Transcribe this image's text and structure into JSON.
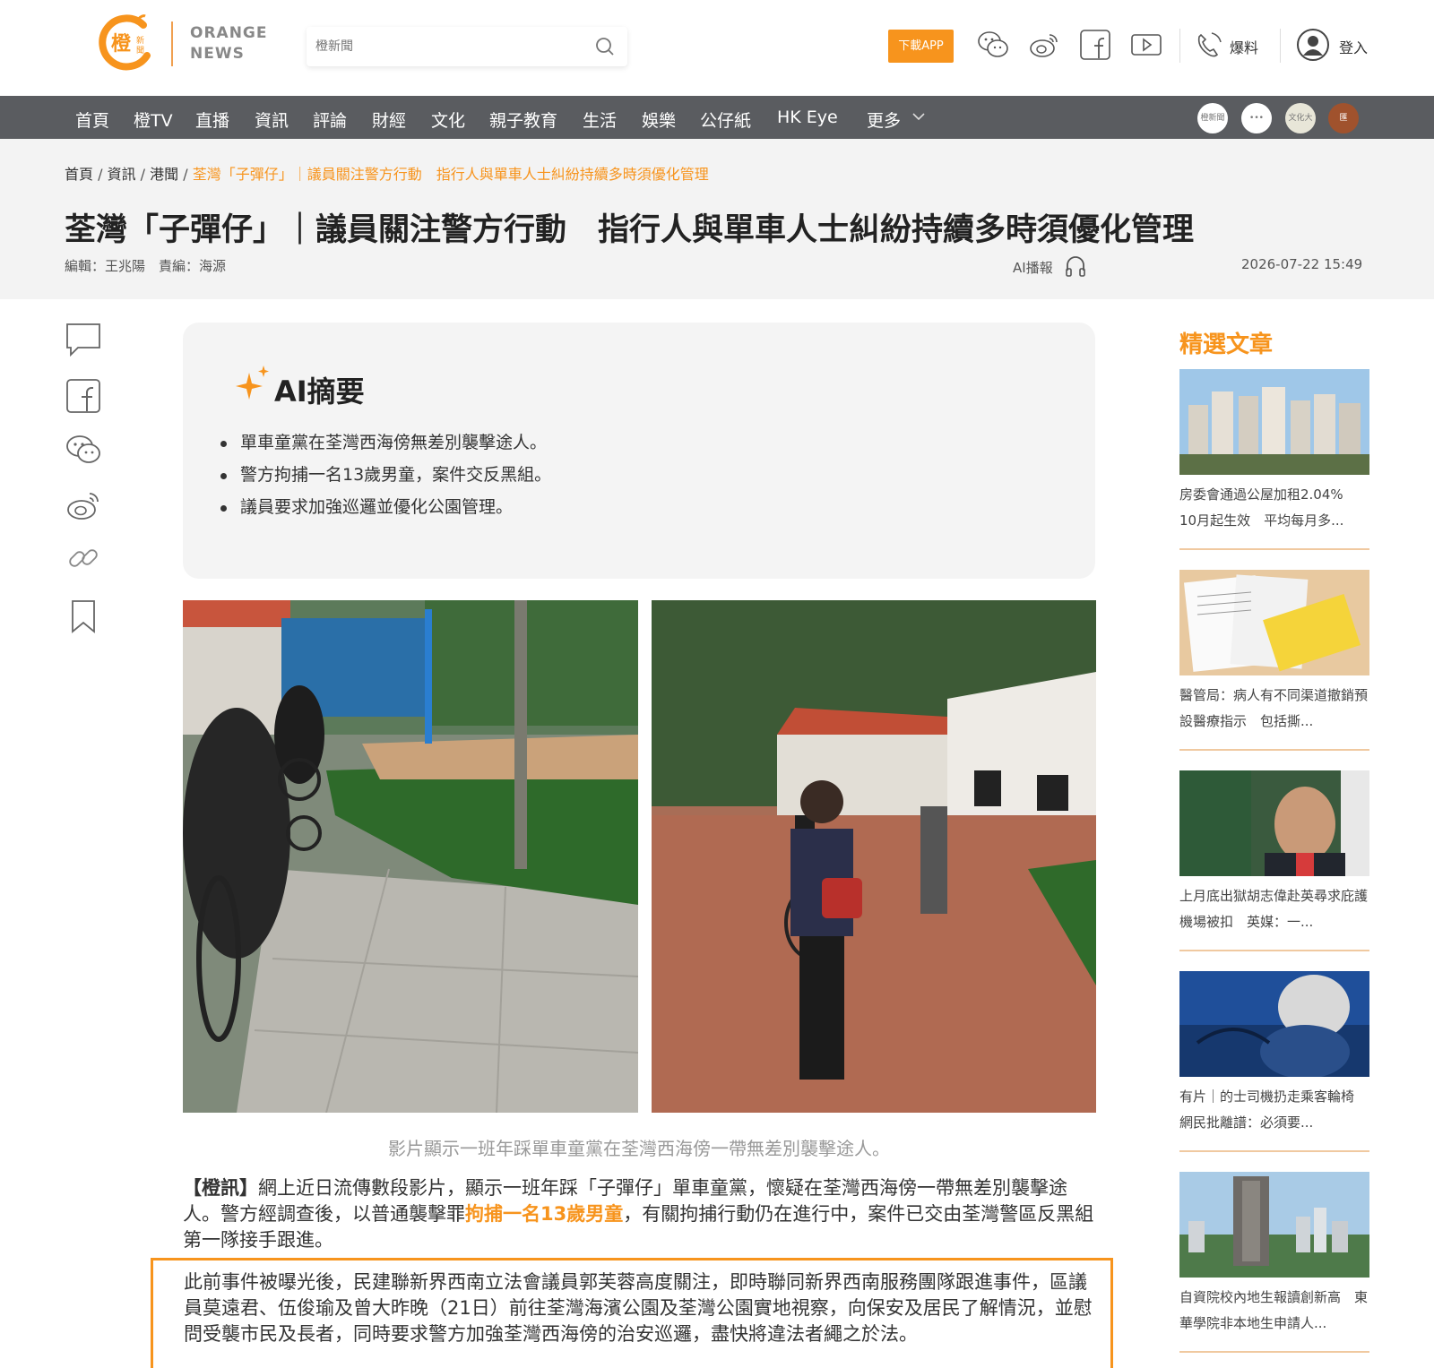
{
  "header": {
    "logo_glyph": "橙",
    "logo_small": "新聞",
    "logo_text_1": "ORANGE",
    "logo_text_2": "NEWS",
    "search_placeholder": "橙新聞",
    "download_app": "下載APP",
    "report_label": "爆料",
    "login_label": "登入"
  },
  "nav": {
    "items": [
      "首頁",
      "橙TV",
      "直播",
      "資訊",
      "評論",
      "財經",
      "文化",
      "親子教育",
      "生活",
      "娛樂",
      "公仔紙",
      "HK Eye",
      "更多"
    ],
    "circles": [
      "橙新聞",
      "•••",
      "文化大匯",
      "匯"
    ]
  },
  "breadcrumb": {
    "items": [
      "首頁",
      "資訊",
      "港聞"
    ],
    "current": "荃灣「子彈仔」｜議員關注警方行動　指行人與單車人士糾紛持續多時須優化管理"
  },
  "article": {
    "title": "荃灣「子彈仔」｜議員關注警方行動　指行人與單車人士糾紛持續多時須優化管理",
    "editor": "編輯：王兆陽　責編：海源",
    "ai_play": "AI播報",
    "date": "2026-07-22 15:49",
    "ai_summary_title": "AI摘要",
    "ai_summary": [
      "單車童黨在荃灣西海傍無差別襲擊途人。",
      "警方拘捕一名13歲男童，案件交反黑組。",
      "議員要求加強巡邏並優化公園管理。"
    ],
    "caption": "影片顯示一班年踩單車童黨在荃灣西海傍一帶無差別襲擊途人。",
    "para_source": "【橙訊】",
    "para_1a": "網上近日流傳數段影片，顯示一班年踩「子彈仔」單車童黨，懷疑在荃灣西海傍一帶無差別襲擊途人。警方經調查後，以普通襲擊罪",
    "para_1_highlight": "拘捕一名13歲男童",
    "para_1b": "，有關拘捕行動仍在進行中，案件已交由荃灣警區反黑組第一隊接手跟進。",
    "para_2": "此前事件被曝光後，民建聯新界西南立法會議員郭芙蓉高度關注，即時聯同新界西南服務團隊跟進事件，區議員莫遠君、伍俊瑜及曾大昨晚（21日）前往荃灣海濱公園及荃灣公園實地視察，向保安及居民了解情況，並慰問受襲市民及長者，同時要求警方加強荃灣西海傍的治安巡邏，盡快將違法者繩之於法。"
  },
  "sidebar": {
    "title": "精選文章",
    "cards": [
      {
        "caption": "房委會通過公屋加租2.04%　10月起生效　平均每月多..."
      },
      {
        "caption": "醫管局：病人有不同渠道撤銷預設醫療指示　包括撕..."
      },
      {
        "caption": "上月底出獄胡志偉赴英尋求庇護機場被扣　英媒：一..."
      },
      {
        "caption": "有片｜的士司機扔走乘客輪椅　網民批離譜：必須要..."
      },
      {
        "caption": "自資院校內地生報讀創新高　東華學院非本地生申請人..."
      }
    ]
  },
  "colors": {
    "accent": "#f7941d",
    "nav_bg": "#5a5c60"
  }
}
